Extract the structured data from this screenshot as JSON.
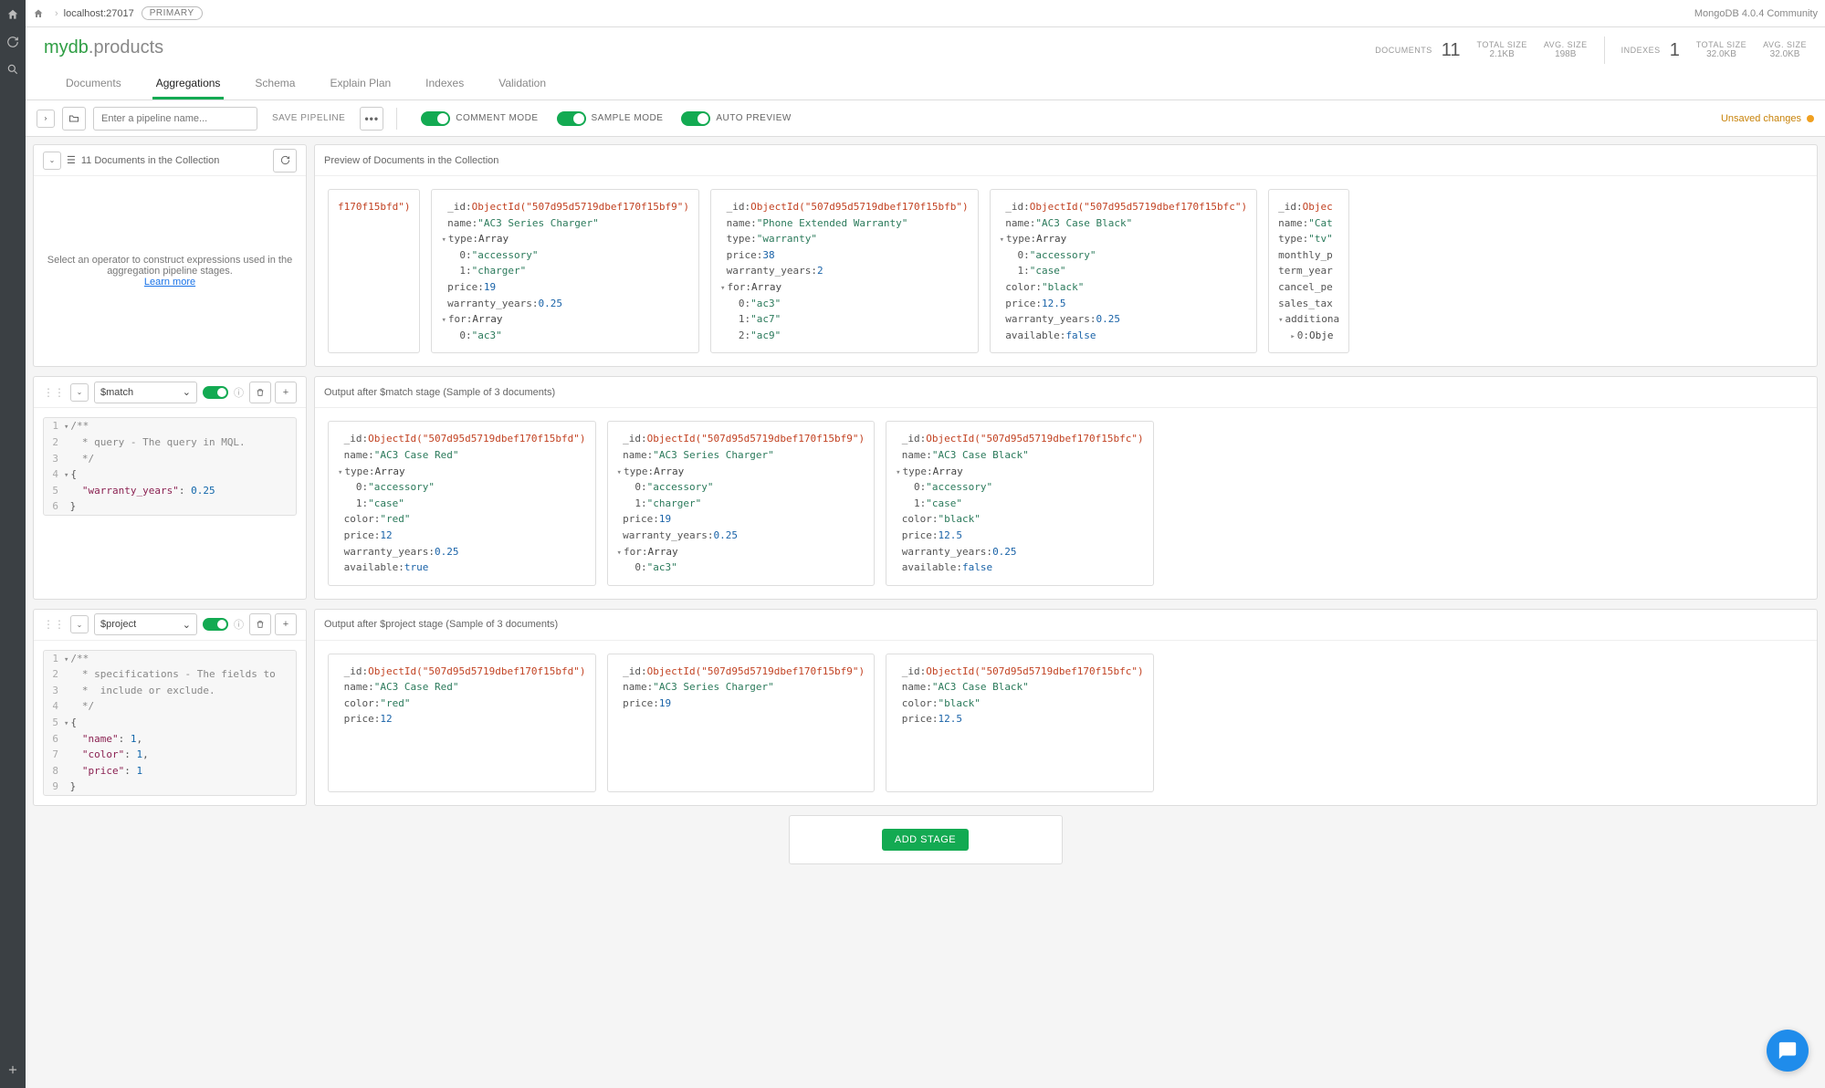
{
  "topbar": {
    "address": "localhost:27017",
    "badge": "PRIMARY",
    "version": "MongoDB 4.0.4 Community"
  },
  "namespace": {
    "db": "mydb",
    "coll": ".products"
  },
  "stats": {
    "documents_label": "DOCUMENTS",
    "documents_count": "11",
    "docs_total_size_lbl": "TOTAL SIZE",
    "docs_total_size": "2.1KB",
    "docs_avg_size_lbl": "AVG. SIZE",
    "docs_avg_size": "198B",
    "indexes_label": "INDEXES",
    "indexes_count": "1",
    "idx_total_size_lbl": "TOTAL SIZE",
    "idx_total_size": "32.0KB",
    "idx_avg_size_lbl": "AVG. SIZE",
    "idx_avg_size": "32.0KB"
  },
  "tabs": {
    "documents": "Documents",
    "aggregations": "Aggregations",
    "schema": "Schema",
    "explain": "Explain Plan",
    "indexes": "Indexes",
    "validation": "Validation"
  },
  "toolbar": {
    "pipeline_placeholder": "Enter a pipeline name...",
    "save": "SAVE PIPELINE",
    "comment_mode": "COMMENT MODE",
    "sample_mode": "SAMPLE MODE",
    "auto_preview": "AUTO PREVIEW",
    "unsaved": "Unsaved changes"
  },
  "source": {
    "docs_in_collection": "11 Documents in the Collection",
    "preview_label": "Preview of Documents in the Collection",
    "helper_text": "Select an operator to construct expressions used in the aggregation pipeline stages.",
    "learn_more": "Learn more"
  },
  "preview_docs": {
    "d0_frag": "f170f15bfd\")",
    "d1_id": "ObjectId(\"507d95d5719dbef170f15bf9\")",
    "d1_name": "\"AC3 Series Charger\"",
    "d1_t0": "\"accessory\"",
    "d1_t1": "\"charger\"",
    "d1_price": "19",
    "d1_wy": "0.25",
    "d1_for0": "\"ac3\"",
    "d2_id": "ObjectId(\"507d95d5719dbef170f15bfb\")",
    "d2_name": "\"Phone Extended Warranty\"",
    "d2_type": "\"warranty\"",
    "d2_price": "38",
    "d2_wy": "2",
    "d2_for0": "\"ac3\"",
    "d2_for1": "\"ac7\"",
    "d2_for2": "\"ac9\"",
    "d3_id": "ObjectId(\"507d95d5719dbef170f15bfc\")",
    "d3_name": "\"AC3 Case Black\"",
    "d3_t0": "\"accessory\"",
    "d3_t1": "\"case\"",
    "d3_color": "\"black\"",
    "d3_price": "12.5",
    "d3_wy": "0.25",
    "d3_avail": "false",
    "d4_name": "\"Cat",
    "d4_type": "\"tv\""
  },
  "stage1": {
    "name": "$match",
    "output_label": "Output after $match stage (Sample of 3 documents)",
    "code": {
      "l1": "/**",
      "l2": " * query - The query in MQL.",
      "l3": " */",
      "l4": "{",
      "l5_key": "\"warranty_years\"",
      "l5_val": "0.25",
      "l6": "}"
    },
    "out": {
      "a_id": "ObjectId(\"507d95d5719dbef170f15bfd\")",
      "a_name": "\"AC3 Case Red\"",
      "a_t0": "\"accessory\"",
      "a_t1": "\"case\"",
      "a_color": "\"red\"",
      "a_price": "12",
      "a_wy": "0.25",
      "a_avail": "true",
      "b_id": "ObjectId(\"507d95d5719dbef170f15bf9\")",
      "b_name": "\"AC3 Series Charger\"",
      "b_t0": "\"accessory\"",
      "b_t1": "\"charger\"",
      "b_price": "19",
      "b_wy": "0.25",
      "b_for0": "\"ac3\"",
      "c_id": "ObjectId(\"507d95d5719dbef170f15bfc\")",
      "c_name": "\"AC3 Case Black\"",
      "c_t0": "\"accessory\"",
      "c_t1": "\"case\"",
      "c_color": "\"black\"",
      "c_price": "12.5",
      "c_wy": "0.25",
      "c_avail": "false"
    }
  },
  "stage2": {
    "name": "$project",
    "output_label": "Output after $project stage (Sample of 3 documents)",
    "code": {
      "l1": "/**",
      "l2": " * specifications - The fields to",
      "l3": " *  include or exclude.",
      "l4": " */",
      "l5": "{",
      "l6k": "\"name\"",
      "l6v": "1",
      "l7k": "\"color\"",
      "l7v": "1",
      "l8k": "\"price\"",
      "l8v": "1",
      "l9": "}"
    },
    "out": {
      "a_id": "ObjectId(\"507d95d5719dbef170f15bfd\")",
      "a_name": "\"AC3 Case Red\"",
      "a_color": "\"red\"",
      "a_price": "12",
      "b_id": "ObjectId(\"507d95d5719dbef170f15bf9\")",
      "b_name": "\"AC3 Series Charger\"",
      "b_price": "19",
      "c_id": "ObjectId(\"507d95d5719dbef170f15bfc\")",
      "c_name": "\"AC3 Case Black\"",
      "c_color": "\"black\"",
      "c_price": "12.5"
    }
  },
  "add_stage": "ADD STAGE"
}
